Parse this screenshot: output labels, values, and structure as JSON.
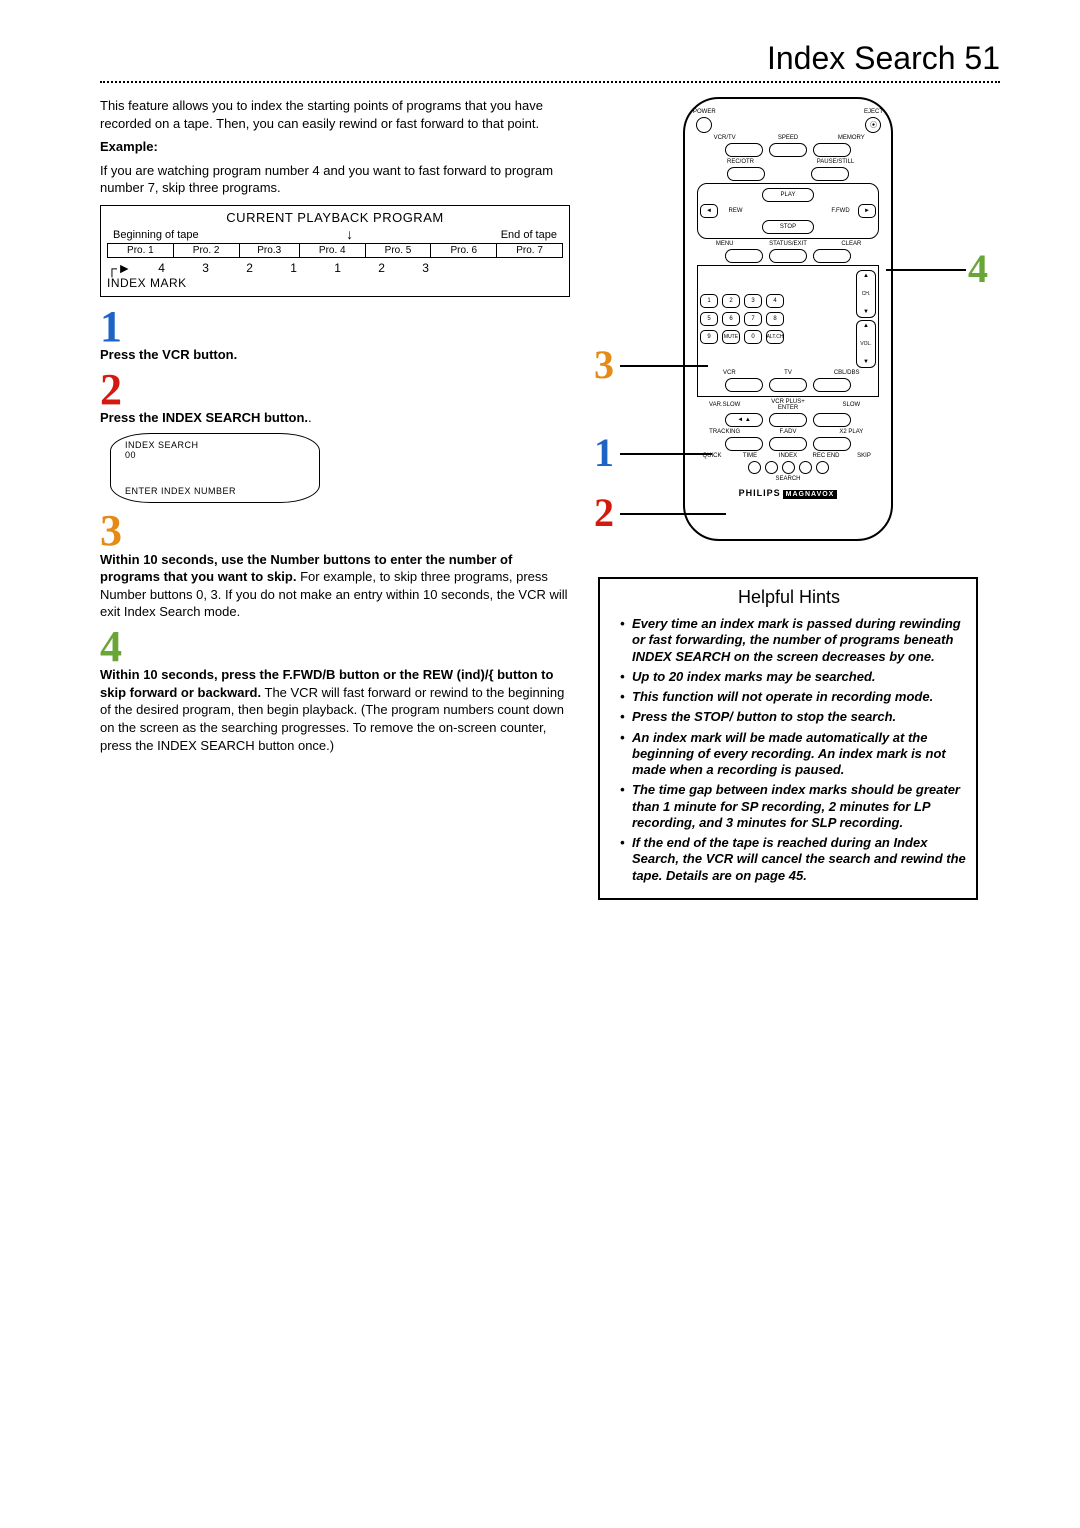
{
  "page": {
    "title": "Index Search",
    "number": "51"
  },
  "intro": {
    "p1": "This feature allows you to index the starting points of programs that you have recorded on a tape. Then, you can easily rewind or fast forward to that point.",
    "example_label": "Example:",
    "p2": "If you are watching program number 4 and you want to fast forward to program number 7, skip three programs."
  },
  "diagram": {
    "title": "CURRENT PLAYBACK PROGRAM",
    "left": "Beginning of tape",
    "right": "End of tape",
    "cells": [
      "Pro. 1",
      "Pro. 2",
      "Pro.3",
      "Pro. 4",
      "Pro. 5",
      "Pro. 6",
      "Pro. 7"
    ],
    "nums": [
      "4",
      "3",
      "2",
      "1",
      "1",
      "2",
      "3"
    ],
    "index_mark": "INDEX MARK"
  },
  "steps": {
    "s1": {
      "num": "1",
      "text": "Press the VCR button."
    },
    "s2": {
      "num": "2",
      "text": "Press the INDEX SEARCH button."
    },
    "screen": {
      "l1": "INDEX SEARCH",
      "l2": "00",
      "l3": "ENTER INDEX NUMBER"
    },
    "s3": {
      "num": "3",
      "b": "Within 10 seconds, use the Number buttons to enter the number of programs that you want to skip.",
      "t": "For example, to skip three programs, press Number buttons 0, 3.  If you do not make an entry within 10 seconds, the VCR will exit Index Search mode."
    },
    "s4": {
      "num": "4",
      "b": "Within 10 seconds, press the F.FWD/B  button or the REW (ind)/{  button to skip forward or backward.",
      "t": "The VCR will fast forward or rewind to the beginning of the desired program, then begin playback. (The program numbers count down on the screen as the searching progresses. To remove the on-screen counter, press the INDEX SEARCH button once.)"
    }
  },
  "remote": {
    "power": "POWER",
    "eject": "EJECT",
    "vcrtv": "VCR/TV",
    "speed": "SPEED",
    "memory": "MEMORY",
    "recotr": "REC/OTR",
    "pausestill": "PAUSE/STILL",
    "play": "PLAY",
    "rew": "REW",
    "ffwd": "F.FWD",
    "stop": "STOP",
    "menu": "MENU",
    "statusexit": "STATUS/EXIT",
    "clear": "CLEAR",
    "nums": [
      "1",
      "2",
      "3",
      "4",
      "5",
      "6",
      "7",
      "8",
      "9",
      "0"
    ],
    "mute": "MUTE",
    "altch": "ALT.CH",
    "ch": "CH.",
    "vol": "VOL.",
    "vcr": "VCR",
    "tv": "TV",
    "cbldbs": "CBL/DBS",
    "varslow": "VAR.SLOW",
    "vcrplus": "VCR PLUS+\nENTER",
    "slow": "SLOW",
    "tracking": "TRACKING",
    "fadv": "F.ADV",
    "x2play": "X2 PLAY",
    "quick": "QUICK",
    "time": "TIME",
    "index": "INDEX",
    "recend": "REC END",
    "skip": "SKIP",
    "search": "SEARCH",
    "brand": "PHILIPS",
    "brand2": "MAGNAVOX"
  },
  "hints": {
    "title": "Helpful Hints",
    "items": [
      "Every time an index mark is passed during rewinding or fast forwarding, the number of programs beneath INDEX SEARCH on the screen decreases by one.",
      "Up to 20 index marks may be searched.",
      "This function will not operate in recording mode.",
      "Press the STOP/ button to stop the search.",
      "An index mark will be made automatically at the beginning of every recording. An index mark is not made when a recording is paused.",
      "The time gap between index marks should be greater than 1 minute for SP recording, 2 minutes for LP recording, and 3 minutes for SLP recording.",
      "If the end of the tape is reached during an Index Search, the VCR will cancel the search and rewind the tape. Details are on page 45."
    ]
  }
}
